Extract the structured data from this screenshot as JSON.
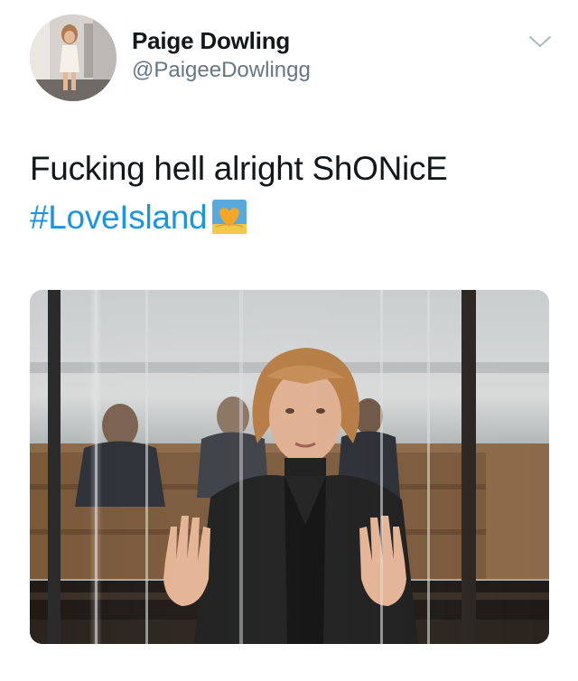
{
  "tweet": {
    "author": {
      "display_name": "Paige Dowling",
      "handle": "@PaigeeDowlingg"
    },
    "text": "Fucking hell alright ShONicE",
    "hashtag": "#LoveIsland",
    "emoji": "heart-on-island-icon"
  },
  "colors": {
    "link": "#1b95e0",
    "text": "#14171a",
    "secondary": "#657786"
  }
}
